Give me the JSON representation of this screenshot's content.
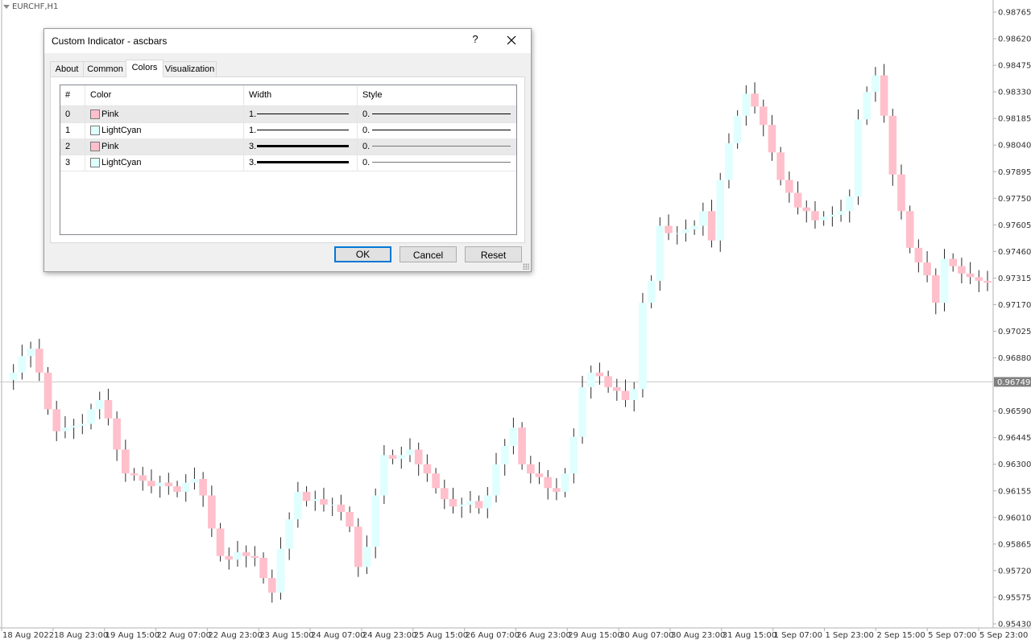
{
  "chart": {
    "symbol": "EURCHF,H1",
    "current_price": "0.96749",
    "price_labels": [
      "0.98765",
      "0.98620",
      "0.98475",
      "0.98330",
      "0.98185",
      "0.98040",
      "0.97895",
      "0.97750",
      "0.97605",
      "0.97460",
      "0.97315",
      "0.97170",
      "0.97025",
      "0.96880",
      "0.96590",
      "0.96445",
      "0.96300",
      "0.96155",
      "0.96010",
      "0.95865",
      "0.95720",
      "0.95575",
      "0.95430"
    ],
    "time_labels": [
      "18 Aug 2022",
      "18 Aug 23:00",
      "19 Aug 15:00",
      "22 Aug 07:00",
      "22 Aug 23:00",
      "23 Aug 15:00",
      "24 Aug 07:00",
      "24 Aug 23:00",
      "25 Aug 15:00",
      "26 Aug 07:00",
      "26 Aug 23:00",
      "29 Aug 15:00",
      "30 Aug 07:00",
      "30 Aug 23:00",
      "31 Aug 15:00",
      "1 Sep 07:00",
      "1 Sep 23:00",
      "2 Sep 15:00",
      "5 Sep 07:00",
      "5 Sep 23:00"
    ],
    "colors": {
      "bear": "#ffc0cb",
      "bull": "#e0ffff",
      "wick": "#2a2a2a",
      "axis": "#b0b0b0",
      "price_tag_bg": "#808080"
    },
    "close_series": [
      0.9676,
      0.968,
      0.9689,
      0.9693,
      0.968,
      0.966,
      0.9648,
      0.965,
      0.9651,
      0.9652,
      0.966,
      0.9665,
      0.9655,
      0.9638,
      0.9625,
      0.9624,
      0.9621,
      0.9618,
      0.962,
      0.9618,
      0.9615,
      0.962,
      0.9622,
      0.9613,
      0.9595,
      0.958,
      0.9578,
      0.9582,
      0.958,
      0.9579,
      0.9568,
      0.956,
      0.9584,
      0.96,
      0.9615,
      0.961,
      0.9611,
      0.9608,
      0.9608,
      0.9604,
      0.9596,
      0.9574,
      0.9585,
      0.9613,
      0.9635,
      0.9633,
      0.9635,
      0.9638,
      0.963,
      0.9625,
      0.9617,
      0.9611,
      0.9607,
      0.9608,
      0.961,
      0.9606,
      0.9613,
      0.963,
      0.964,
      0.965,
      0.963,
      0.9625,
      0.9623,
      0.9617,
      0.9615,
      0.9625,
      0.9645,
      0.9672,
      0.968,
      0.9678,
      0.9672,
      0.967,
      0.9665,
      0.9671,
      0.9718,
      0.973,
      0.976,
      0.9756,
      0.9756,
      0.9758,
      0.976,
      0.9768,
      0.9752,
      0.9785,
      0.9805,
      0.982,
      0.9832,
      0.9825,
      0.9815,
      0.98,
      0.9785,
      0.9778,
      0.977,
      0.9768,
      0.9763,
      0.9765,
      0.9766,
      0.9768,
      0.9776,
      0.9818,
      0.9833,
      0.9842,
      0.982,
      0.9788,
      0.9768,
      0.9748,
      0.974,
      0.9733,
      0.9718,
      0.9742,
      0.9738,
      0.9734,
      0.9732,
      0.973,
      0.9729
    ]
  },
  "dialog": {
    "title": "Custom Indicator - ascbars",
    "help_label": "?",
    "tabs": [
      "About",
      "Common",
      "Colors",
      "Visualization"
    ],
    "columns": [
      "#",
      "Color",
      "Width",
      "Style"
    ],
    "rows": [
      {
        "index": "0",
        "color_name": "Pink",
        "swatch": "#ffc0cb",
        "width": "1.",
        "style": "0."
      },
      {
        "index": "1",
        "color_name": "LightCyan",
        "swatch": "#e0ffff",
        "width": "1.",
        "style": "0."
      },
      {
        "index": "2",
        "color_name": "Pink",
        "swatch": "#ffc0cb",
        "width": "3.",
        "style": "0."
      },
      {
        "index": "3",
        "color_name": "LightCyan",
        "swatch": "#e0ffff",
        "width": "3.",
        "style": "0."
      }
    ],
    "buttons": {
      "ok": "OK",
      "cancel": "Cancel",
      "reset": "Reset"
    }
  }
}
